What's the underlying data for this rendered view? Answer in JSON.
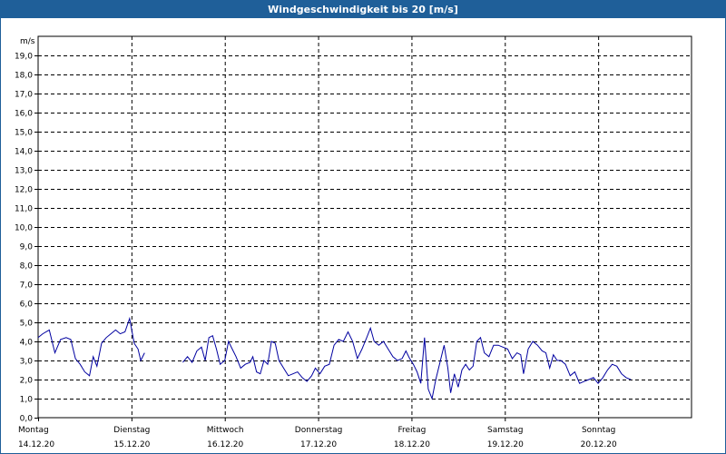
{
  "window": {
    "title": "Windgeschwindigkeit bis 20 [m/s]"
  },
  "chart_data": {
    "type": "line",
    "title": "Windgeschwindigkeit bis 20 [m/s]",
    "unit_label": "m/s",
    "ylim": [
      0,
      20
    ],
    "xlim": [
      0,
      7
    ],
    "yticks": [
      "0,0",
      "1,0",
      "2,0",
      "3,0",
      "4,0",
      "5,0",
      "6,0",
      "7,0",
      "8,0",
      "9,0",
      "10,0",
      "11,0",
      "12,0",
      "13,0",
      "14,0",
      "15,0",
      "16,0",
      "17,0",
      "18,0",
      "19,0"
    ],
    "grid": true,
    "line_color": "#0000a0",
    "days": [
      {
        "name": "Montag",
        "date": "14.12.20"
      },
      {
        "name": "Dienstag",
        "date": "15.12.20"
      },
      {
        "name": "Mittwoch",
        "date": "16.12.20"
      },
      {
        "name": "Donnerstag",
        "date": "17.12.20"
      },
      {
        "name": "Freitag",
        "date": "18.12.20"
      },
      {
        "name": "Samstag",
        "date": "19.12.20"
      },
      {
        "name": "Sonntag",
        "date": "20.12.20"
      }
    ],
    "series": [
      {
        "segments": [
          [
            [
              0.0,
              4.2
            ],
            [
              0.05,
              4.4
            ],
            [
              0.12,
              4.6
            ],
            [
              0.18,
              3.4
            ],
            [
              0.24,
              4.1
            ],
            [
              0.3,
              4.2
            ],
            [
              0.35,
              4.1
            ],
            [
              0.4,
              3.1
            ],
            [
              0.45,
              2.8
            ],
            [
              0.5,
              2.4
            ],
            [
              0.55,
              2.2
            ],
            [
              0.59,
              3.2
            ],
            [
              0.63,
              2.7
            ],
            [
              0.68,
              3.9
            ],
            [
              0.73,
              4.2
            ],
            [
              0.78,
              4.4
            ],
            [
              0.83,
              4.6
            ],
            [
              0.88,
              4.4
            ],
            [
              0.93,
              4.5
            ],
            [
              0.98,
              5.2
            ],
            [
              1.03,
              3.9
            ],
            [
              1.07,
              3.6
            ],
            [
              1.1,
              3.0
            ],
            [
              1.14,
              3.4
            ]
          ],
          [
            [
              1.55,
              2.9
            ],
            [
              1.6,
              3.2
            ],
            [
              1.65,
              2.9
            ],
            [
              1.7,
              3.5
            ],
            [
              1.75,
              3.7
            ],
            [
              1.79,
              3.0
            ],
            [
              1.83,
              4.2
            ],
            [
              1.87,
              4.3
            ],
            [
              1.91,
              3.6
            ],
            [
              1.95,
              2.8
            ],
            [
              2.0,
              3.0
            ],
            [
              2.04,
              4.0
            ],
            [
              2.08,
              3.6
            ],
            [
              2.12,
              3.2
            ],
            [
              2.17,
              2.6
            ],
            [
              2.22,
              2.8
            ],
            [
              2.27,
              2.9
            ],
            [
              2.3,
              3.2
            ],
            [
              2.34,
              2.4
            ],
            [
              2.38,
              2.3
            ],
            [
              2.42,
              3.0
            ],
            [
              2.46,
              2.8
            ],
            [
              2.5,
              4.0
            ],
            [
              2.54,
              3.9
            ],
            [
              2.58,
              3.0
            ],
            [
              2.63,
              2.6
            ],
            [
              2.68,
              2.2
            ],
            [
              2.73,
              2.3
            ],
            [
              2.78,
              2.4
            ],
            [
              2.83,
              2.1
            ],
            [
              2.88,
              1.9
            ],
            [
              2.93,
              2.2
            ],
            [
              2.97,
              2.6
            ],
            [
              3.02,
              2.3
            ],
            [
              3.07,
              2.7
            ],
            [
              3.12,
              2.8
            ],
            [
              3.17,
              3.8
            ],
            [
              3.22,
              4.1
            ],
            [
              3.27,
              4.0
            ],
            [
              3.32,
              4.5
            ],
            [
              3.37,
              4.0
            ],
            [
              3.42,
              3.1
            ],
            [
              3.47,
              3.6
            ],
            [
              3.52,
              4.2
            ],
            [
              3.56,
              4.7
            ],
            [
              3.6,
              4.0
            ],
            [
              3.65,
              3.8
            ],
            [
              3.7,
              4.0
            ],
            [
              3.75,
              3.6
            ],
            [
              3.8,
              3.2
            ],
            [
              3.85,
              3.0
            ],
            [
              3.9,
              3.1
            ],
            [
              3.94,
              3.5
            ],
            [
              3.98,
              3.1
            ],
            [
              4.02,
              2.8
            ],
            [
              4.06,
              2.4
            ],
            [
              4.1,
              1.8
            ],
            [
              4.14,
              4.2
            ],
            [
              4.18,
              1.5
            ],
            [
              4.22,
              1.0
            ],
            [
              4.26,
              2.0
            ],
            [
              4.3,
              2.8
            ],
            [
              4.35,
              3.8
            ],
            [
              4.39,
              2.6
            ],
            [
              4.42,
              1.3
            ],
            [
              4.46,
              2.3
            ],
            [
              4.5,
              1.6
            ],
            [
              4.54,
              2.5
            ],
            [
              4.58,
              2.8
            ],
            [
              4.62,
              2.5
            ],
            [
              4.66,
              2.7
            ],
            [
              4.7,
              4.0
            ],
            [
              4.74,
              4.2
            ],
            [
              4.78,
              3.4
            ],
            [
              4.83,
              3.2
            ],
            [
              4.88,
              3.8
            ],
            [
              4.93,
              3.8
            ],
            [
              4.98,
              3.7
            ],
            [
              5.03,
              3.6
            ],
            [
              5.08,
              3.1
            ],
            [
              5.13,
              3.4
            ],
            [
              5.17,
              3.3
            ],
            [
              5.2,
              2.3
            ],
            [
              5.25,
              3.6
            ],
            [
              5.3,
              4.0
            ],
            [
              5.35,
              3.8
            ],
            [
              5.4,
              3.5
            ],
            [
              5.44,
              3.4
            ],
            [
              5.48,
              2.6
            ],
            [
              5.52,
              3.3
            ],
            [
              5.56,
              3.0
            ],
            [
              5.6,
              3.0
            ],
            [
              5.65,
              2.8
            ],
            [
              5.7,
              2.2
            ],
            [
              5.75,
              2.4
            ],
            [
              5.8,
              1.8
            ],
            [
              5.85,
              1.9
            ],
            [
              5.9,
              2.0
            ],
            [
              5.95,
              2.1
            ],
            [
              6.0,
              1.8
            ],
            [
              6.05,
              2.1
            ],
            [
              6.1,
              2.5
            ],
            [
              6.15,
              2.8
            ],
            [
              6.2,
              2.7
            ],
            [
              6.25,
              2.3
            ],
            [
              6.3,
              2.1
            ],
            [
              6.35,
              2.0
            ]
          ]
        ]
      }
    ]
  }
}
